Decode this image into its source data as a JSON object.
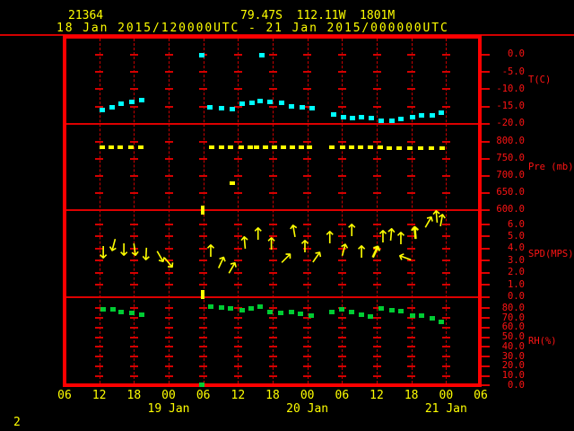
{
  "header": {
    "station_id": "21364",
    "position": "79.47S  112.11W  1801M",
    "period": "18 Jan 2015/120000UTC - 21 Jan 2015/000000UTC"
  },
  "footer": {
    "page_indicator": "2"
  },
  "colors": {
    "background": "#000000",
    "frame": "#ff0000",
    "grid": "#c80000",
    "axis_text": "#ff1414",
    "time_text": "#ffff00",
    "temperature": "#00ffff",
    "pressure": "#ffff00",
    "wind": "#ffff00",
    "humidity": "#00cc33"
  },
  "x_axis": {
    "unit": "hours since 18 Jan 2015 0600UTC",
    "span_hours": 72,
    "hour_labels": [
      "06",
      "12",
      "18",
      "00",
      "06",
      "12",
      "18",
      "00",
      "06",
      "12",
      "18",
      "00",
      "06"
    ],
    "date_labels": [
      {
        "label": "19 Jan",
        "tick_index": 3
      },
      {
        "label": "20 Jan",
        "tick_index": 7
      },
      {
        "label": "21 Jan",
        "tick_index": 11
      }
    ]
  },
  "chart_data": [
    {
      "type": "scatter",
      "panel": "temperature",
      "ylabel": "T(C)",
      "color": "#00ffff",
      "ylim": [
        -20.1,
        4.9
      ],
      "grid": true,
      "yticks": [
        {
          "v": 0,
          "label": "0.0"
        },
        {
          "v": -5,
          "label": "-5.0"
        },
        {
          "v": -10,
          "label": "-10.0"
        },
        {
          "v": -15,
          "label": "-15.0"
        },
        {
          "v": -20,
          "label": "-20.0"
        }
      ],
      "series": [
        {
          "name": "temperature",
          "points": [
            [
              6.5,
              -16.0
            ],
            [
              8.2,
              -15.3
            ],
            [
              9.8,
              -14.3
            ],
            [
              11.6,
              -13.8
            ],
            [
              13.3,
              -13.2
            ],
            [
              25.1,
              -15.3
            ],
            [
              27.2,
              -15.5
            ],
            [
              29.0,
              -15.8
            ],
            [
              30.7,
              -14.3
            ],
            [
              32.4,
              -14.0
            ],
            [
              33.8,
              -13.5
            ],
            [
              35.6,
              -13.7
            ],
            [
              37.6,
              -14.0
            ],
            [
              39.3,
              -15.0
            ],
            [
              41.1,
              -15.3
            ],
            [
              42.8,
              -15.5
            ],
            [
              46.6,
              -17.3
            ],
            [
              48.2,
              -18.1
            ],
            [
              49.8,
              -18.3
            ],
            [
              51.4,
              -18.1
            ],
            [
              53.0,
              -18.3
            ],
            [
              54.8,
              -19.1
            ],
            [
              56.6,
              -19.1
            ],
            [
              58.2,
              -18.6
            ],
            [
              60.2,
              -18.1
            ],
            [
              61.8,
              -17.6
            ],
            [
              63.6,
              -17.6
            ],
            [
              65.2,
              -16.8
            ]
          ]
        },
        {
          "name": "outliers",
          "points": [
            [
              23.7,
              -0.2
            ],
            [
              34.1,
              -0.2
            ]
          ]
        }
      ]
    },
    {
      "type": "scatter",
      "panel": "pressure",
      "ylabel": "Pre (mb)",
      "color": "#ffff00",
      "ylim": [
        600,
        852
      ],
      "grid": true,
      "yticks": [
        {
          "v": 800,
          "label": "800.0"
        },
        {
          "v": 750,
          "label": "750.0"
        },
        {
          "v": 700,
          "label": "700.0"
        },
        {
          "v": 650,
          "label": "650.0"
        },
        {
          "v": 600,
          "label": "600.0"
        }
      ],
      "series": [
        {
          "name": "pressure",
          "points": [
            [
              6.5,
              783
            ],
            [
              8.1,
              783
            ],
            [
              9.6,
              783
            ],
            [
              11.5,
              783
            ],
            [
              13.2,
              783
            ],
            [
              25.4,
              783
            ],
            [
              27.2,
              783
            ],
            [
              28.7,
              783
            ],
            [
              30.5,
              783
            ],
            [
              32.1,
              783
            ],
            [
              33.2,
              783
            ],
            [
              34.7,
              783
            ],
            [
              36.3,
              783
            ],
            [
              37.9,
              783
            ],
            [
              39.4,
              783
            ],
            [
              41.0,
              783
            ],
            [
              42.4,
              783
            ],
            [
              46.2,
              783
            ],
            [
              48.1,
              783
            ],
            [
              49.7,
              783
            ],
            [
              51.2,
              783
            ],
            [
              52.9,
              783
            ],
            [
              54.6,
              783
            ],
            [
              56.2,
              782
            ],
            [
              57.9,
              781
            ],
            [
              59.7,
              780
            ],
            [
              61.6,
              780
            ],
            [
              63.5,
              782
            ],
            [
              65.3,
              782
            ]
          ]
        },
        {
          "name": "outliers",
          "points": [
            [
              29.0,
              678
            ]
          ]
        }
      ],
      "spike_marks": [
        [
          23.9,
          598
        ]
      ]
    },
    {
      "type": "scatter",
      "panel": "wind-speed",
      "mark": "arrow",
      "ylabel": "SPD(MPS)",
      "color": "#ffff00",
      "ylim": [
        0,
        7.2
      ],
      "grid": true,
      "yticks": [
        {
          "v": 6,
          "label": "6.0"
        },
        {
          "v": 5,
          "label": "5.0"
        },
        {
          "v": 4,
          "label": "4.0"
        },
        {
          "v": 3,
          "label": "3.0"
        },
        {
          "v": 2,
          "label": "2.0"
        },
        {
          "v": 1,
          "label": "1.0"
        },
        {
          "v": 0,
          "label": "0.0"
        }
      ],
      "arrows_format": "[hours, speed_mps, direction_deg_cw_from_up, bold]",
      "arrows": [
        [
          6.7,
          3.8,
          180,
          0
        ],
        [
          8.5,
          4.4,
          195,
          0
        ],
        [
          10.2,
          4.0,
          180,
          0
        ],
        [
          12.1,
          4.0,
          172,
          0
        ],
        [
          14.1,
          3.6,
          183,
          0
        ],
        [
          16.4,
          3.4,
          150,
          0
        ],
        [
          17.9,
          2.9,
          140,
          0
        ],
        [
          25.3,
          3.7,
          0,
          0
        ],
        [
          27.0,
          2.7,
          25,
          0
        ],
        [
          28.9,
          2.3,
          30,
          0
        ],
        [
          31.2,
          4.4,
          355,
          0
        ],
        [
          33.5,
          5.1,
          0,
          0
        ],
        [
          35.8,
          4.3,
          0,
          0
        ],
        [
          38.2,
          3.1,
          45,
          0
        ],
        [
          39.7,
          5.3,
          350,
          0
        ],
        [
          41.6,
          4.1,
          0,
          0
        ],
        [
          43.4,
          3.2,
          35,
          0
        ],
        [
          45.9,
          4.8,
          0,
          0
        ],
        [
          48.3,
          3.8,
          15,
          0
        ],
        [
          49.7,
          5.4,
          0,
          0
        ],
        [
          51.4,
          3.6,
          0,
          0
        ],
        [
          53.7,
          3.6,
          25,
          1
        ],
        [
          55.1,
          4.9,
          0,
          0
        ],
        [
          56.5,
          5.0,
          5,
          0
        ],
        [
          58.2,
          4.7,
          0,
          0
        ],
        [
          59.1,
          3.2,
          290,
          0
        ],
        [
          60.7,
          5.2,
          355,
          1
        ],
        [
          62.9,
          6.1,
          30,
          0
        ],
        [
          64.4,
          6.5,
          355,
          0
        ],
        [
          65.2,
          6.2,
          10,
          0
        ]
      ],
      "calm_marks": [
        [
          23.9,
          0.2
        ]
      ]
    },
    {
      "type": "scatter",
      "panel": "relative-humidity",
      "ylabel": "RH(%)",
      "color": "#00cc33",
      "ylim": [
        0,
        91.7
      ],
      "grid": true,
      "yticks": [
        {
          "v": 80,
          "label": "80.0"
        },
        {
          "v": 70,
          "label": "70.0"
        },
        {
          "v": 60,
          "label": "60.0"
        },
        {
          "v": 50,
          "label": "50.0"
        },
        {
          "v": 40,
          "label": "40.0"
        },
        {
          "v": 30,
          "label": "30.0"
        },
        {
          "v": 20,
          "label": "20.0"
        },
        {
          "v": 10,
          "label": "10.0"
        },
        {
          "v": 0,
          "label": "0.0"
        }
      ],
      "series": [
        {
          "name": "humidity",
          "points": [
            [
              6.7,
              79
            ],
            [
              8.4,
              79
            ],
            [
              9.8,
              76
            ],
            [
              11.6,
              75
            ],
            [
              13.3,
              73
            ],
            [
              25.3,
              82
            ],
            [
              27.2,
              81
            ],
            [
              28.7,
              80
            ],
            [
              30.7,
              78
            ],
            [
              32.3,
              80
            ],
            [
              33.8,
              82
            ],
            [
              35.5,
              76
            ],
            [
              37.4,
              75
            ],
            [
              39.3,
              76
            ],
            [
              40.8,
              74
            ],
            [
              42.7,
              72
            ],
            [
              46.2,
              76
            ],
            [
              47.9,
              79
            ],
            [
              49.7,
              76
            ],
            [
              51.4,
              73
            ],
            [
              52.9,
              71
            ],
            [
              54.8,
              80
            ],
            [
              56.6,
              78
            ],
            [
              58.2,
              77
            ],
            [
              60.2,
              72
            ],
            [
              61.8,
              72
            ],
            [
              63.6,
              70
            ],
            [
              65.2,
              66
            ]
          ]
        },
        {
          "name": "outliers",
          "points": [
            [
              23.7,
              1
            ]
          ]
        }
      ]
    }
  ]
}
